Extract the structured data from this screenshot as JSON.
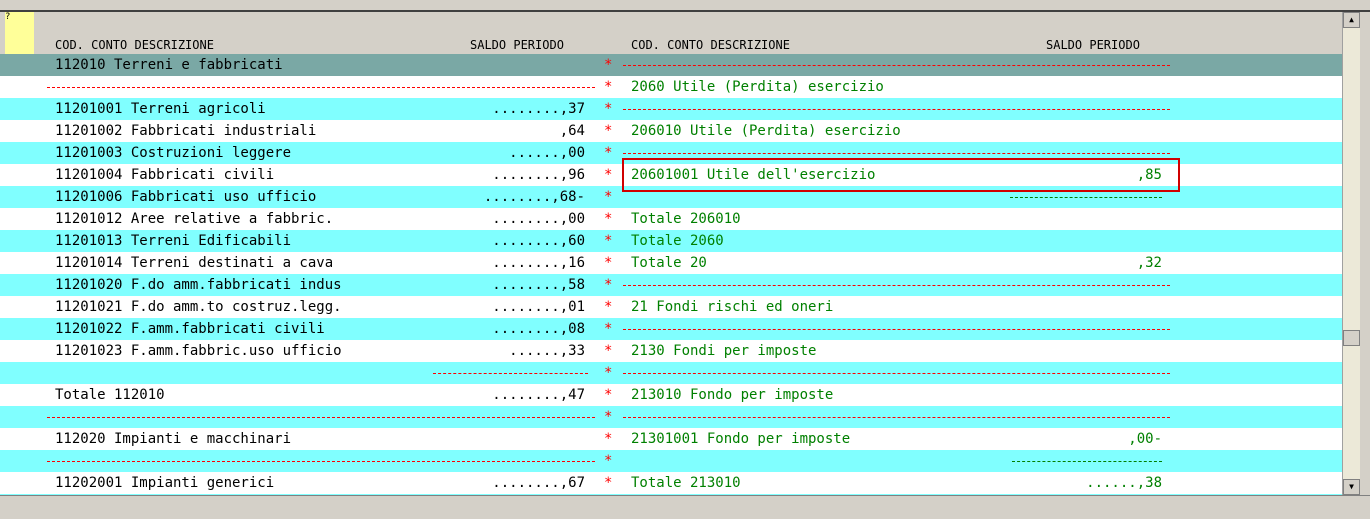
{
  "help_label": "?",
  "header": {
    "left_code": "COD. CONTO DESCRIZIONE",
    "left_balance": "SALDO PERIODO",
    "right_code": "COD. CONTO DESCRIZIONE",
    "right_balance": "SALDO PERIODO"
  },
  "separator_star": "*",
  "rows": [
    {
      "style": "first",
      "ld": "112010 Terreni e fabbricati",
      "lv": "",
      "rd": "",
      "rv": "",
      "ldash": null,
      "rdash": [
        623,
        1170
      ]
    },
    {
      "style": "w",
      "ld": "",
      "lv": "",
      "rd": "2060 Utile (Perdita) esercizio",
      "rv": "",
      "ldash": [
        47,
        595
      ],
      "rdash": null
    },
    {
      "style": "c",
      "ld": "11201001 Terreni agricoli",
      "lv": "........,37",
      "rd": "",
      "rv": "",
      "ldash": null,
      "rdash": [
        623,
        1170
      ]
    },
    {
      "style": "w",
      "ld": "11201002 Fabbricati industriali",
      "lv": ",64",
      "rd": "206010 Utile (Perdita) esercizio",
      "rv": "",
      "ldash": null,
      "rdash": null
    },
    {
      "style": "c",
      "ld": "11201003 Costruzioni leggere",
      "lv": "......,00",
      "rd": "",
      "rv": "",
      "ldash": null,
      "rdash": [
        623,
        1170
      ]
    },
    {
      "style": "w",
      "ld": "11201004 Fabbricati civili",
      "lv": "........,96",
      "rd": "20601001 Utile dell'esercizio",
      "rv": ",85",
      "ldash": null,
      "rdash": null
    },
    {
      "style": "c",
      "ld": "11201006 Fabbricati uso ufficio",
      "lv": "........,68-",
      "rd": "",
      "rv": "",
      "ldash": null,
      "rdash": null,
      "rdash_green": [
        1010,
        1162
      ]
    },
    {
      "style": "w",
      "ld": "11201012 Aree relative a fabbric.",
      "lv": "........,00",
      "rd": "Totale 206010",
      "rv": "",
      "ldash": null,
      "rdash": null
    },
    {
      "style": "c",
      "ld": "11201013 Terreni Edificabili",
      "lv": "........,60",
      "rd": "Totale 2060",
      "rv": "",
      "ldash": null,
      "rdash": null
    },
    {
      "style": "w",
      "ld": "11201014 Terreni destinati a cava",
      "lv": "........,16",
      "rd": "Totale 20",
      "rv": ",32",
      "ldash": null,
      "rdash": null
    },
    {
      "style": "c",
      "ld": "11201020 F.do amm.fabbricati indus",
      "lv": "........,58",
      "rd": "",
      "rv": "",
      "ldash": null,
      "rdash": [
        623,
        1170
      ]
    },
    {
      "style": "w",
      "ld": "11201021 F.do amm.to costruz.legg.",
      "lv": "........,01",
      "rd": "21 Fondi rischi ed oneri",
      "rv": "",
      "ldash": null,
      "rdash": null
    },
    {
      "style": "c",
      "ld": "11201022 F.amm.fabbricati civili",
      "lv": "........,08",
      "rd": "",
      "rv": "",
      "ldash": null,
      "rdash": [
        623,
        1170
      ]
    },
    {
      "style": "w",
      "ld": "11201023 F.amm.fabbric.uso ufficio",
      "lv": "......,33",
      "rd": "2130 Fondi per imposte",
      "rv": "",
      "ldash": null,
      "rdash": null
    },
    {
      "style": "c",
      "ld": "",
      "lv": "",
      "rd": "",
      "rv": "",
      "ldash": [
        433,
        588
      ],
      "rdash": [
        623,
        1170
      ]
    },
    {
      "style": "w",
      "ld": "Totale 112010",
      "lv": "........,47",
      "rd": "213010 Fondo per imposte",
      "rv": "",
      "ldash": null,
      "rdash": null
    },
    {
      "style": "c",
      "ld": "",
      "lv": "",
      "rd": "",
      "rv": "",
      "ldash": [
        47,
        595
      ],
      "rdash": [
        623,
        1170
      ]
    },
    {
      "style": "w",
      "ld": "112020 Impianti e macchinari",
      "lv": "",
      "rd": "21301001 Fondo per imposte",
      "rv": ",00-",
      "ldash": null,
      "rdash": null
    },
    {
      "style": "c",
      "ld": "",
      "lv": "",
      "rd": "",
      "rv": "",
      "ldash": [
        47,
        595
      ],
      "rdash": null,
      "rdash_green": [
        1012,
        1162
      ]
    },
    {
      "style": "w",
      "ld": "11202001 Impianti generici",
      "lv": "........,67",
      "rd": "Totale 213010",
      "rv": "......,38",
      "ldash": null,
      "rdash": null
    },
    {
      "style": "c",
      "ld": "",
      "lv": "",
      "rd": "",
      "rv": "",
      "ldash": null,
      "rdash": null
    }
  ],
  "colors": {
    "cyan": "#80ffff",
    "teal": "#7aa8a5",
    "red": "#ff0000",
    "green": "#008000",
    "highlight": "#d00000"
  },
  "scroll_icons": {
    "up": "triangle-up-icon",
    "down": "triangle-down-icon"
  }
}
